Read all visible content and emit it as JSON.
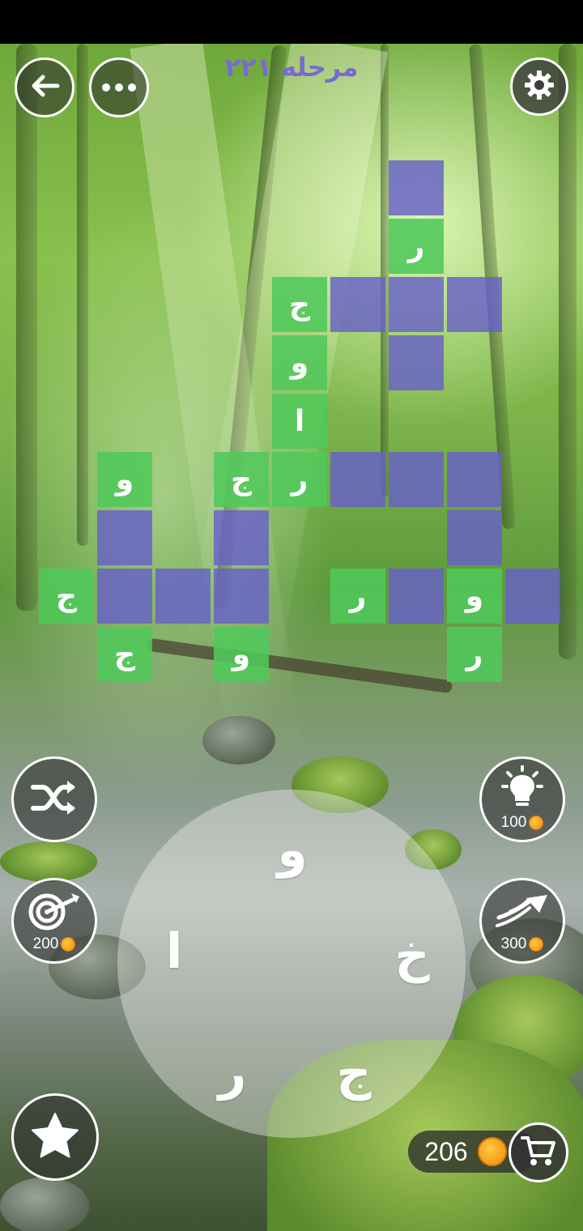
{
  "header": {
    "level_title": "مرحله ۲۲۱"
  },
  "colors": {
    "filled_tile": "#50c85a",
    "empty_tile": "#6860c8",
    "level_title": "#7a6ad0",
    "coin": "#f7a21b"
  },
  "grid": {
    "rows": [
      [
        "",
        "",
        "",
        "",
        "",
        "",
        "",
        "",
        "",
        ""
      ],
      [
        "",
        "",
        "",
        "",
        "",
        "",
        "ر",
        "",
        "",
        ""
      ],
      [
        "",
        "",
        "",
        "",
        "ج",
        "",
        "",
        "",
        "",
        ""
      ],
      [
        "",
        "",
        "",
        "",
        "و",
        "",
        "",
        "",
        "",
        ""
      ],
      [
        "",
        "",
        "",
        "",
        "ا",
        "",
        "",
        "",
        "",
        ""
      ],
      [
        "",
        "و",
        "",
        "ج",
        "ر",
        "",
        "",
        "",
        "",
        ""
      ],
      [
        "",
        "",
        "",
        "",
        "",
        "",
        "",
        "",
        "",
        ""
      ],
      [
        "ج",
        "",
        "",
        "",
        "",
        "ر",
        "",
        "و",
        "",
        ""
      ],
      [
        "",
        "ج",
        "",
        "و",
        "",
        "",
        "",
        "ر",
        "",
        ""
      ]
    ]
  },
  "wheel": {
    "letters": [
      "و",
      "خ",
      "ج",
      "ر",
      "ا"
    ]
  },
  "powerups": {
    "shuffle": {
      "icon": "shuffle-icon"
    },
    "hint": {
      "icon": "lightbulb-icon",
      "cost": "100"
    },
    "target": {
      "icon": "target-icon",
      "cost": "200"
    },
    "rocket": {
      "icon": "rocket-icon",
      "cost": "300"
    },
    "favorites": {
      "icon": "star-icon"
    }
  },
  "wallet": {
    "coins": "206",
    "icon": "cart-icon"
  },
  "toolbar": {
    "back_icon": "back-arrow-icon",
    "menu_icon": "more-icon",
    "settings_icon": "gear-icon"
  }
}
